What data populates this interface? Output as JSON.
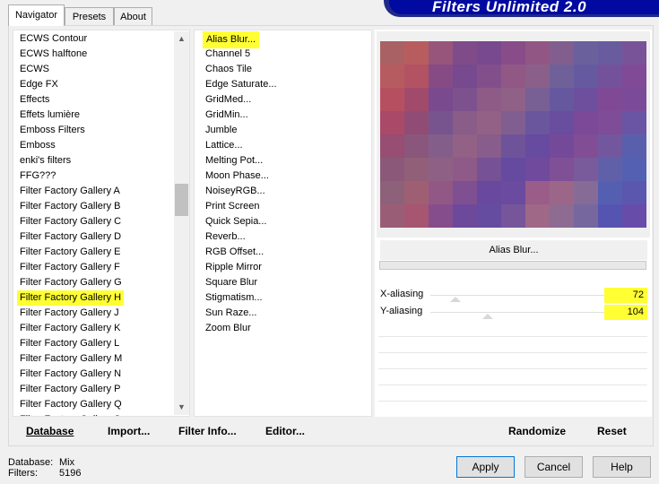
{
  "tabs": [
    {
      "label": "Navigator",
      "active": true
    },
    {
      "label": "Presets",
      "active": false
    },
    {
      "label": "About",
      "active": false
    }
  ],
  "logo": "Filters Unlimited 2.0",
  "categories": [
    "ECWS Contour",
    "ECWS halftone",
    "ECWS",
    "Edge FX",
    "Effects",
    "Effets lumière",
    "Emboss Filters",
    "Emboss",
    "enki's filters",
    "FFG???",
    "Filter Factory Gallery A",
    "Filter Factory Gallery B",
    "Filter Factory Gallery C",
    "Filter Factory Gallery D",
    "Filter Factory Gallery E",
    "Filter Factory Gallery F",
    "Filter Factory Gallery G",
    "Filter Factory Gallery H",
    "Filter Factory Gallery J",
    "Filter Factory Gallery K",
    "Filter Factory Gallery L",
    "Filter Factory Gallery M",
    "Filter Factory Gallery N",
    "Filter Factory Gallery P",
    "Filter Factory Gallery Q",
    "Filter Factory Gallery S"
  ],
  "selected_category": "Filter Factory Gallery H",
  "filters": [
    "Alias Blur...",
    "Channel 5",
    "Chaos Tile",
    "Edge Saturate...",
    "GridMed...",
    "GridMin...",
    "Jumble",
    "Lattice...",
    "Melting Pot...",
    "Moon Phase...",
    "NoiseyRGB...",
    "Print Screen",
    "Quick Sepia...",
    "Reverb...",
    "RGB Offset...",
    "Ripple Mirror",
    "Square Blur",
    "Stigmatism...",
    "Sun Raze...",
    "Zoom Blur"
  ],
  "selected_filter": "Alias Blur...",
  "filter_name": "Alias Blur...",
  "sliders": [
    {
      "label": "X-aliasing",
      "value": "72"
    },
    {
      "label": "Y-aliasing",
      "value": "104"
    }
  ],
  "buttons": {
    "database": "Database",
    "import": "Import...",
    "filter_info": "Filter Info...",
    "editor": "Editor...",
    "randomize": "Randomize",
    "reset": "Reset",
    "apply": "Apply",
    "cancel": "Cancel",
    "help": "Help"
  },
  "status": {
    "database_label": "Database:",
    "database_value": "Mix",
    "filters_label": "Filters:",
    "filters_value": "5196"
  },
  "colors": {
    "highlight": "#ffff33",
    "logo_bg": "#000aa0"
  }
}
